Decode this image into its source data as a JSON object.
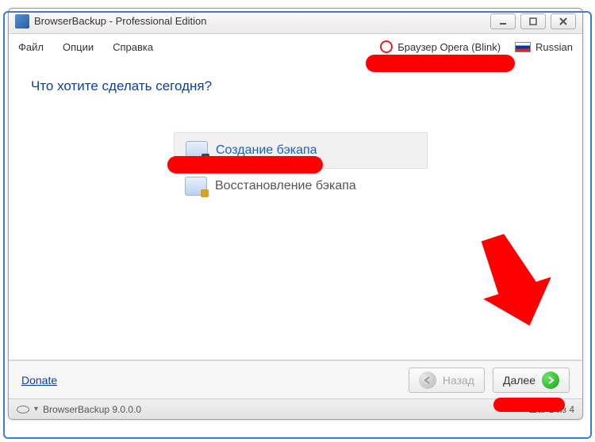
{
  "titlebar": {
    "title": "BrowserBackup - Professional Edition"
  },
  "menu": {
    "file": "Файл",
    "options": "Опции",
    "help": "Справка"
  },
  "header_right": {
    "browser": "Браузер Opera (Blink)",
    "language": "Russian"
  },
  "main": {
    "prompt": "Что хотите сделать сегодня?",
    "options": {
      "create": "Создание бэкапа",
      "restore": "Восстановление бэкапа"
    }
  },
  "footer": {
    "donate": "Donate",
    "back": "Назад",
    "next": "Далее"
  },
  "status": {
    "product": "BrowserBackup 9.0.0.0",
    "step": "Шаг 1 из 4"
  }
}
